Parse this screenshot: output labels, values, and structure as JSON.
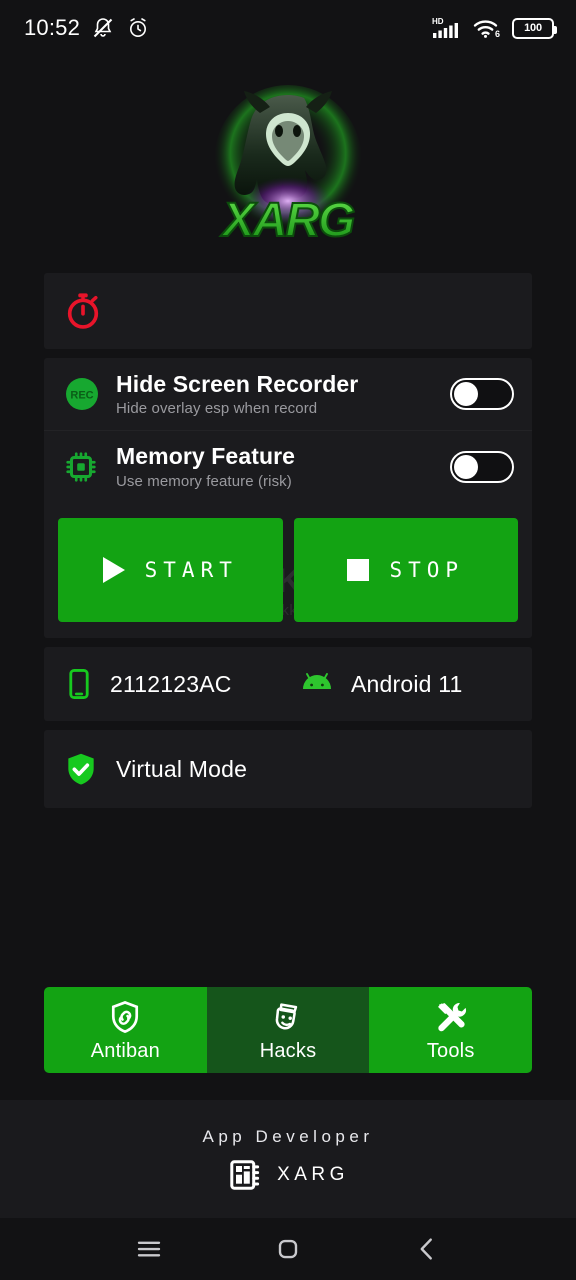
{
  "statusbar": {
    "time": "10:52",
    "icons": [
      "silent-mode-icon",
      "alarm-icon"
    ],
    "network_label": "HD",
    "wifi_generation": "6",
    "battery_level": "100"
  },
  "logo": {
    "name": "xarg-mascot-logo",
    "wordmark": "XARG"
  },
  "timer_card": {
    "icon": "stopwatch-icon",
    "icon_color": "#e8142a",
    "label": ""
  },
  "settings": [
    {
      "icon": "rec-icon",
      "icon_text": "REC",
      "title": "Hide Screen Recorder",
      "subtitle": "Hide overlay esp when record",
      "toggle_state": "off"
    },
    {
      "icon": "memory-chip-icon",
      "title": "Memory Feature",
      "subtitle": "Use memory feature (risk)",
      "toggle_state": "off"
    }
  ],
  "actions": {
    "start_label": "START",
    "start_icon": "play-icon",
    "stop_label": "STOP",
    "stop_icon": "stop-square-icon",
    "accent_color": "#13a313"
  },
  "watermark": {
    "logo_text": "KKX",
    "url": "www.kkx.net"
  },
  "device": {
    "phone_icon": "smartphone-icon",
    "model": "2112123AC",
    "android_icon": "android-robot-icon",
    "os_version": "Android 11"
  },
  "virtual_mode": {
    "icon": "shield-check-icon",
    "label": "Virtual Mode"
  },
  "tabs": [
    {
      "label": "Antiban",
      "icon": "shield-link-icon",
      "active": false
    },
    {
      "label": "Hacks",
      "icon": "theater-masks-icon",
      "active": true
    },
    {
      "label": "Tools",
      "icon": "wrench-screwdriver-icon",
      "active": false
    }
  ],
  "footer": {
    "title": "App Developer",
    "icon": "chip-logo-icon",
    "developer": "XARG"
  },
  "navbar": [
    {
      "name": "recents-button",
      "icon": "menu-lines-icon"
    },
    {
      "name": "home-button",
      "icon": "rounded-square-icon"
    },
    {
      "name": "back-button",
      "icon": "chevron-left-icon"
    }
  ]
}
